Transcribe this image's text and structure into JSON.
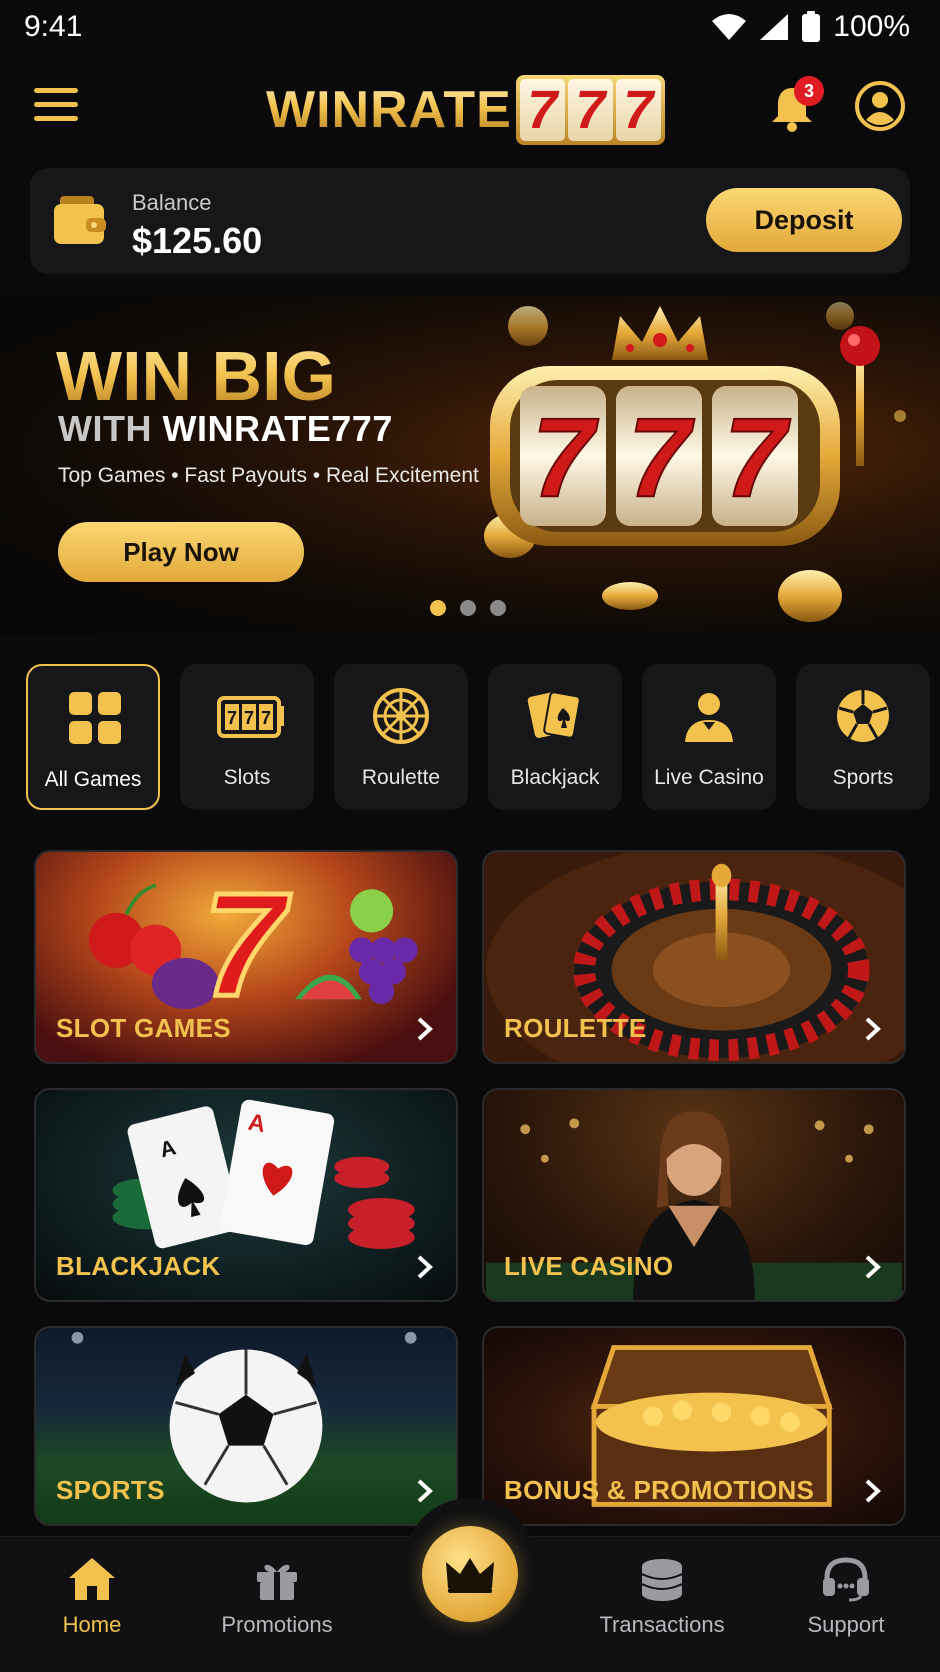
{
  "status_bar": {
    "time": "9:41",
    "battery": "100%"
  },
  "header": {
    "logo_text": "WINRATE",
    "logo_reels": [
      "7",
      "7",
      "7"
    ],
    "notification_count": "3"
  },
  "balance": {
    "label": "Balance",
    "value": "$125.60",
    "deposit_label": "Deposit"
  },
  "hero": {
    "title_line1": "WIN BIG",
    "title_line2_prefix": "WITH",
    "title_line2_brand": "WINRATE777",
    "subtitle": "Top Games • Fast Payouts • Real Excitement",
    "cta_label": "Play Now",
    "reels": [
      "7",
      "7",
      "7"
    ],
    "slides_total": 3,
    "active_slide": 1
  },
  "categories": [
    {
      "label": "All Games",
      "icon": "grid-icon",
      "active": true
    },
    {
      "label": "Slots",
      "icon": "slot-machine-icon"
    },
    {
      "label": "Roulette",
      "icon": "roulette-wheel-icon"
    },
    {
      "label": "Blackjack",
      "icon": "playing-cards-icon"
    },
    {
      "label": "Live Casino",
      "icon": "dealer-icon"
    },
    {
      "label": "Sports",
      "icon": "soccer-ball-icon"
    }
  ],
  "game_cards": [
    {
      "label": "SLOT GAMES",
      "art": "fruit-and-seven-art"
    },
    {
      "label": "ROULETTE",
      "art": "roulette-wheel-art"
    },
    {
      "label": "BLACKJACK",
      "art": "aces-and-chips-art"
    },
    {
      "label": "LIVE CASINO",
      "art": "live-dealer-art"
    },
    {
      "label": "SPORTS",
      "art": "soccer-stadium-art"
    },
    {
      "label": "BONUS & PROMOTIONS",
      "art": "treasure-chest-art"
    }
  ],
  "bottom_nav": [
    {
      "label": "Home",
      "icon": "home-icon",
      "active": true
    },
    {
      "label": "Promotions",
      "icon": "gift-icon"
    },
    {
      "label": "",
      "icon": "crown-icon"
    },
    {
      "label": "Transactions",
      "icon": "coins-stack-icon"
    },
    {
      "label": "Support",
      "icon": "headset-icon"
    }
  ],
  "colors": {
    "accent": "#f2c14e",
    "background": "#0a0a0b",
    "card": "#17171a",
    "badge": "#e01b24",
    "reel_red": "#d01a1a"
  }
}
